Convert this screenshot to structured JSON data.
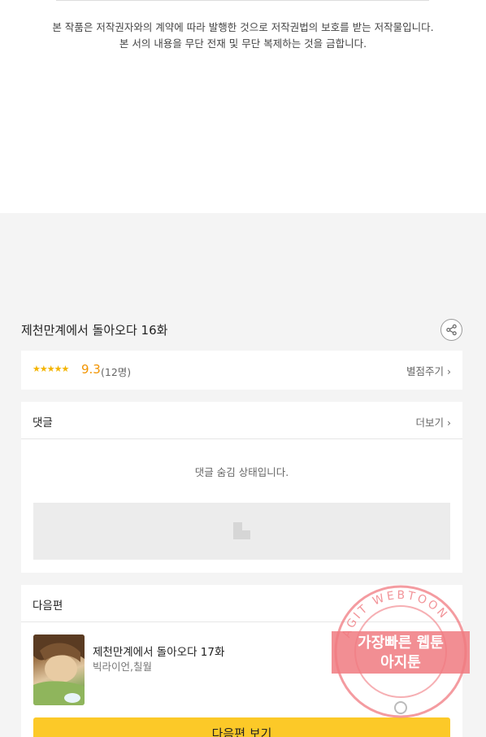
{
  "copyright": {
    "line1": "본 작품은 저작권자와의 계약에 따라 발행한 것으로 저작권법의 보호를 받는 저작물입니다.",
    "line2": "본 서의 내용을 무단 전재 및 무단 복제하는 것을 금합니다."
  },
  "episode": {
    "title": "제천만계에서 돌아오다 16화",
    "share_icon": "share-icon"
  },
  "rating": {
    "stars": "★★★★★",
    "score": "9.3",
    "count": "(12명)",
    "rate_link": "별점주기 ›"
  },
  "comments": {
    "header": "댓글",
    "more_link": "더보기 ›",
    "hidden_message": "댓글 숨김 상태입니다."
  },
  "next": {
    "header": "다음편",
    "title": "제천만계에서 돌아오다 17화",
    "author": "빅라이언,칠월",
    "button": "다음편 보기"
  },
  "watermark": {
    "ring_text": "AGIT WEBTOON",
    "line1": "가장빠른 웹툰",
    "line2": "아지툰",
    "color": "#f07a80"
  },
  "colors": {
    "accent_yellow": "#fcc928",
    "score_orange": "#f29400",
    "background": "#f4f4f4"
  }
}
